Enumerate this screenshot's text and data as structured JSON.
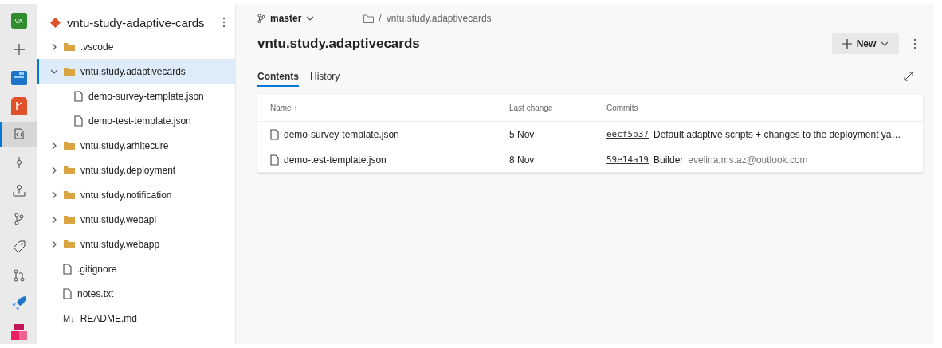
{
  "rail": [
    {
      "kind": "avatar",
      "text": "VA",
      "selected": false
    },
    {
      "kind": "plus",
      "selected": false
    },
    {
      "kind": "boards",
      "selected": false
    },
    {
      "kind": "repos",
      "selected": false
    },
    {
      "kind": "files",
      "selected": true
    },
    {
      "kind": "commits",
      "selected": false
    },
    {
      "kind": "pushes",
      "selected": false
    },
    {
      "kind": "branches",
      "selected": false
    },
    {
      "kind": "tags",
      "selected": false
    },
    {
      "kind": "pulls",
      "selected": false
    },
    {
      "kind": "pipelines",
      "selected": false
    },
    {
      "kind": "artifacts",
      "selected": false
    }
  ],
  "sidebar": {
    "repo_name": "vntu-study-adaptive-cards",
    "tree": [
      {
        "kind": "folder",
        "label": ".vscode",
        "expanded": false,
        "selected": false
      },
      {
        "kind": "folder",
        "label": "vntu.study.adaptivecards",
        "expanded": true,
        "selected": true,
        "children": [
          {
            "kind": "file",
            "label": "demo-survey-template.json",
            "selected": false
          },
          {
            "kind": "file",
            "label": "demo-test-template.json",
            "selected": false
          }
        ]
      },
      {
        "kind": "folder",
        "label": "vntu.study.arhitecure",
        "expanded": false,
        "selected": false
      },
      {
        "kind": "folder",
        "label": "vntu.study.deployment",
        "expanded": false,
        "selected": false
      },
      {
        "kind": "folder",
        "label": "vntu.study.notification",
        "expanded": false,
        "selected": false
      },
      {
        "kind": "folder",
        "label": "vntu.study.webapi",
        "expanded": false,
        "selected": false
      },
      {
        "kind": "folder",
        "label": "vntu.study.webapp",
        "expanded": false,
        "selected": false
      },
      {
        "kind": "file",
        "label": ".gitignore",
        "selected": false
      },
      {
        "kind": "file",
        "label": "notes.txt",
        "selected": false
      },
      {
        "kind": "markdown",
        "icon_text": "M↓",
        "label": "README.md",
        "selected": false
      }
    ]
  },
  "main": {
    "branch": "master",
    "breadcrumb": [
      "/",
      "vntu.study.adaptivecards"
    ],
    "title": "vntu.study.adaptivecards",
    "new_button": "New",
    "tabs": [
      {
        "label": "Contents",
        "selected": true
      },
      {
        "label": "History",
        "selected": false
      }
    ],
    "table": {
      "columns": [
        "Name",
        "Last change",
        "Commits"
      ],
      "sort_mark": "↑",
      "rows": [
        {
          "name": "demo-survey-template.json",
          "last_change": "5 Nov",
          "commit_id": "eecf5b37",
          "message": "Default adaptive scripts + changes to the deployment ya…"
        },
        {
          "name": "demo-test-template.json",
          "last_change": "8 Nov",
          "commit_id": "59e14a19",
          "message": "Builder",
          "author": "evelina.ms.az@outlook.com"
        }
      ]
    }
  }
}
